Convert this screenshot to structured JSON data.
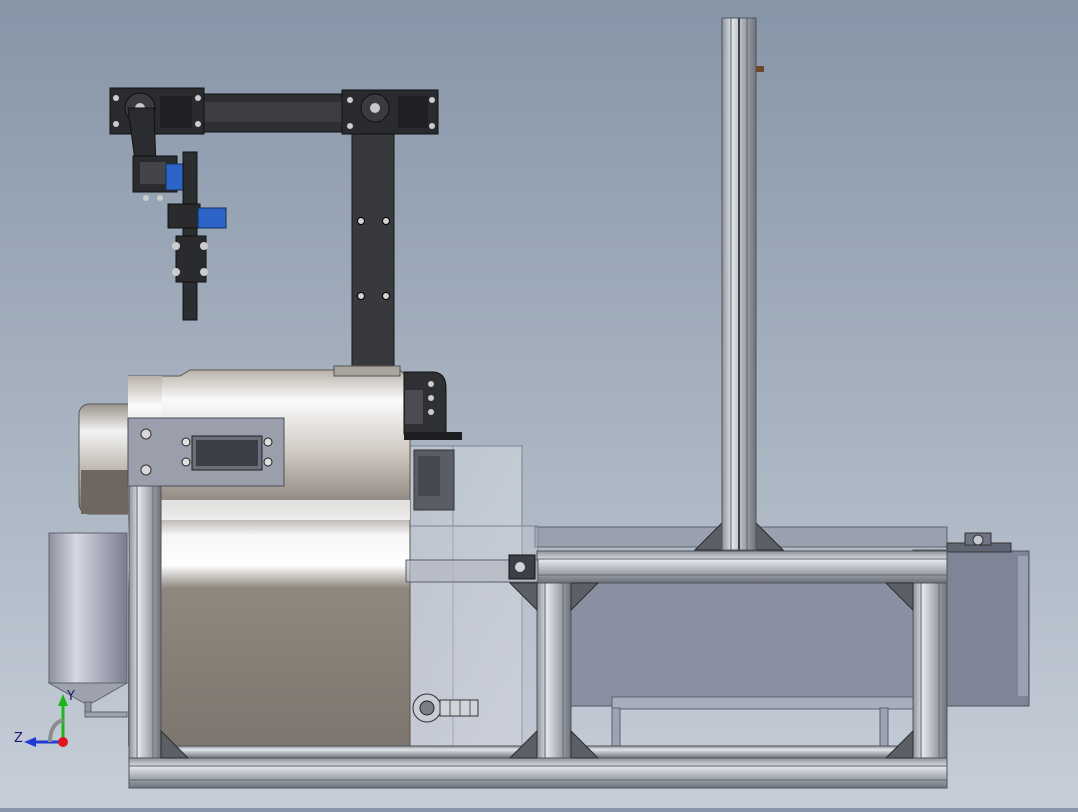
{
  "viewport": {
    "background_top": "#8795a8",
    "background_bottom": "#c6ced8"
  },
  "model": {
    "components": [
      "robot-arm",
      "arm-servo",
      "gripper",
      "mixer-machine",
      "servo-bracket",
      "tall-upright",
      "extrusion-frame",
      "reservoir-tank",
      "funnel-hopper",
      "transparent-enclosure",
      "control-box",
      "pipe-fitting"
    ],
    "colors": {
      "aluminum": "#b8bcc4",
      "arm_dark": "#3a3a3e",
      "servo_blue": "#2c64c8",
      "machine_body": "#7c766e",
      "machine_highlight": "#f0f0f0"
    }
  },
  "triad": {
    "y_label": "Y",
    "z_label": "Z",
    "y_color": "#1db41d",
    "z_color": "#1f3bd8",
    "origin_color": "#e0141e"
  }
}
